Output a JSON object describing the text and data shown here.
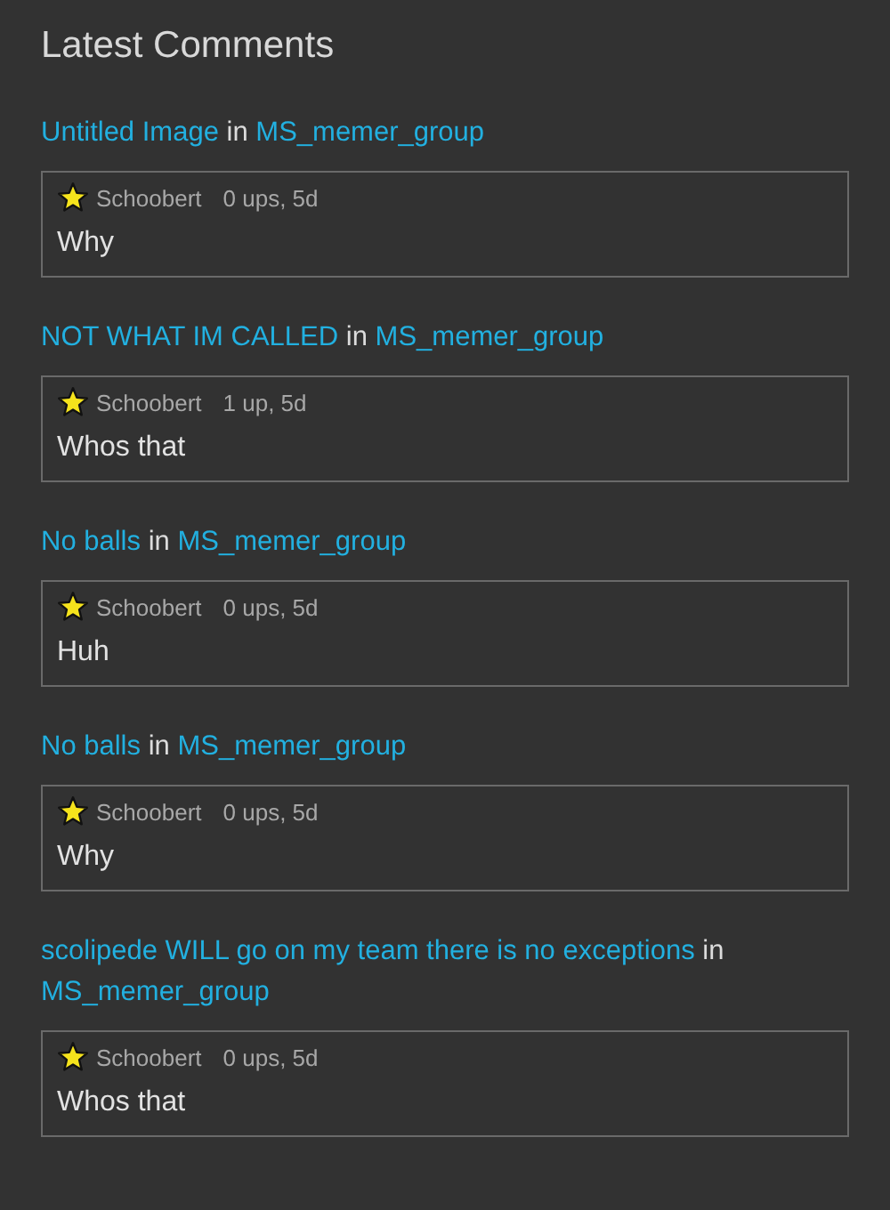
{
  "title": "Latest Comments",
  "comments": [
    {
      "post": "Untitled Image",
      "joiner": "in",
      "group": "MS_memer_group",
      "author": "Schoobert",
      "meta": "0 ups, 5d",
      "text": "Why"
    },
    {
      "post": "NOT WHAT IM CALLED",
      "joiner": "in",
      "group": "MS_memer_group",
      "author": "Schoobert",
      "meta": "1 up, 5d",
      "text": "Whos that"
    },
    {
      "post": "No balls",
      "joiner": "in",
      "group": "MS_memer_group",
      "author": "Schoobert",
      "meta": "0 ups, 5d",
      "text": "Huh"
    },
    {
      "post": "No balls",
      "joiner": "in",
      "group": "MS_memer_group",
      "author": "Schoobert",
      "meta": "0 ups, 5d",
      "text": "Why"
    },
    {
      "post": "scolipede WILL go on my team there is no exceptions",
      "joiner": "in",
      "group": "MS_memer_group",
      "author": "Schoobert",
      "meta": "0 ups, 5d",
      "text": "Whos that"
    }
  ]
}
